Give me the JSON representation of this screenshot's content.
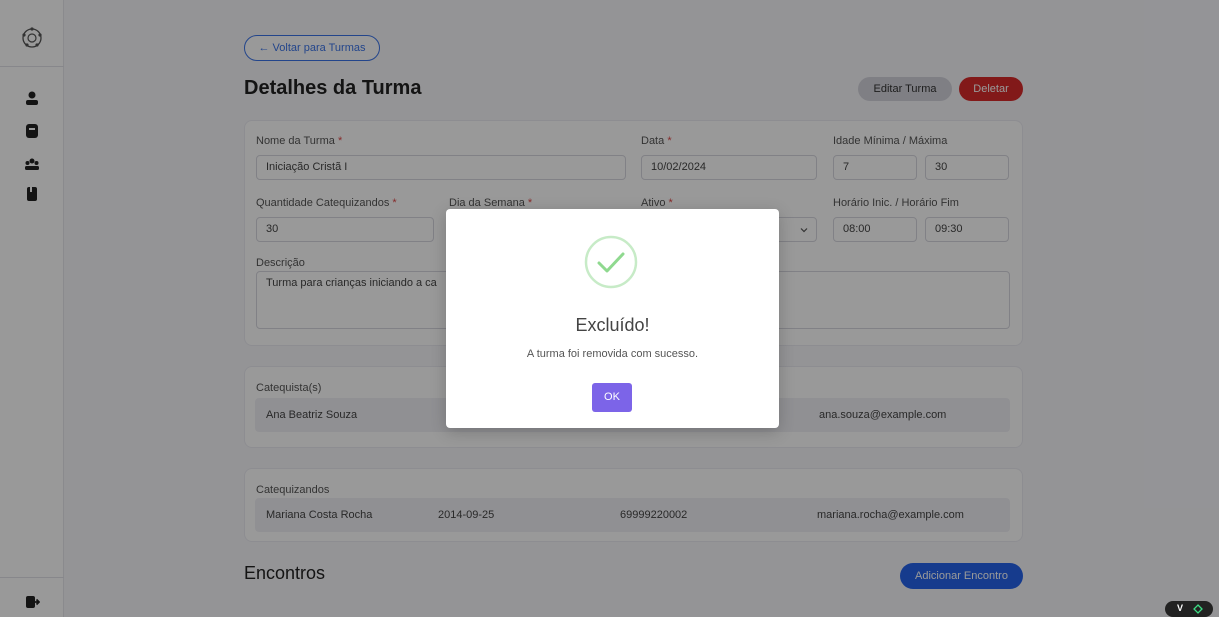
{
  "header": {
    "back_label": "← Voltar para Turmas",
    "title": "Detalhes da Turma",
    "edit_label": "Editar Turma",
    "delete_label": "Deletar"
  },
  "form": {
    "nome_label": "Nome da Turma",
    "nome_value": "Iniciação Cristã I",
    "data_label": "Data",
    "data_value": "10/02/2024",
    "idade_label": "Idade Mínima / Máxima",
    "idade_min": "7",
    "idade_max": "30",
    "qtd_label": "Quantidade Catequizandos",
    "qtd_value": "30",
    "dia_label": "Dia da Semana",
    "ativo_label": "Ativo",
    "horario_label": "Horário Inic. / Horário Fim",
    "horario_inicio": "08:00",
    "horario_fim": "09:30",
    "descricao_label": "Descrição",
    "descricao_value": "Turma para crianças iniciando a ca",
    "required_mark": "*"
  },
  "catequistas": {
    "label": "Catequista(s)",
    "rows": [
      {
        "nome": "Ana Beatriz Souza",
        "email": "ana.souza@example.com"
      }
    ]
  },
  "catequizandos": {
    "label": "Catequizandos",
    "rows": [
      {
        "nome": "Mariana Costa Rocha",
        "nascimento": "2014-09-25",
        "telefone": "69999220002",
        "email": "mariana.rocha@example.com"
      }
    ]
  },
  "encontros": {
    "title": "Encontros",
    "add_label": "Adicionar Encontro"
  },
  "modal": {
    "title": "Excluído!",
    "message": "A turma foi removida com sucesso.",
    "ok_label": "OK",
    "icon": "success-check-icon"
  },
  "sidebar": {
    "icons": [
      "logo-icon",
      "user-icon",
      "book-icon",
      "group-icon",
      "notebook-icon",
      "logout-icon"
    ]
  },
  "dev_badge": {
    "label": "V"
  },
  "colors": {
    "primary": "#2563eb",
    "danger": "#d92b2b",
    "ok": "#7c64e8",
    "success": "#8fd98f"
  }
}
